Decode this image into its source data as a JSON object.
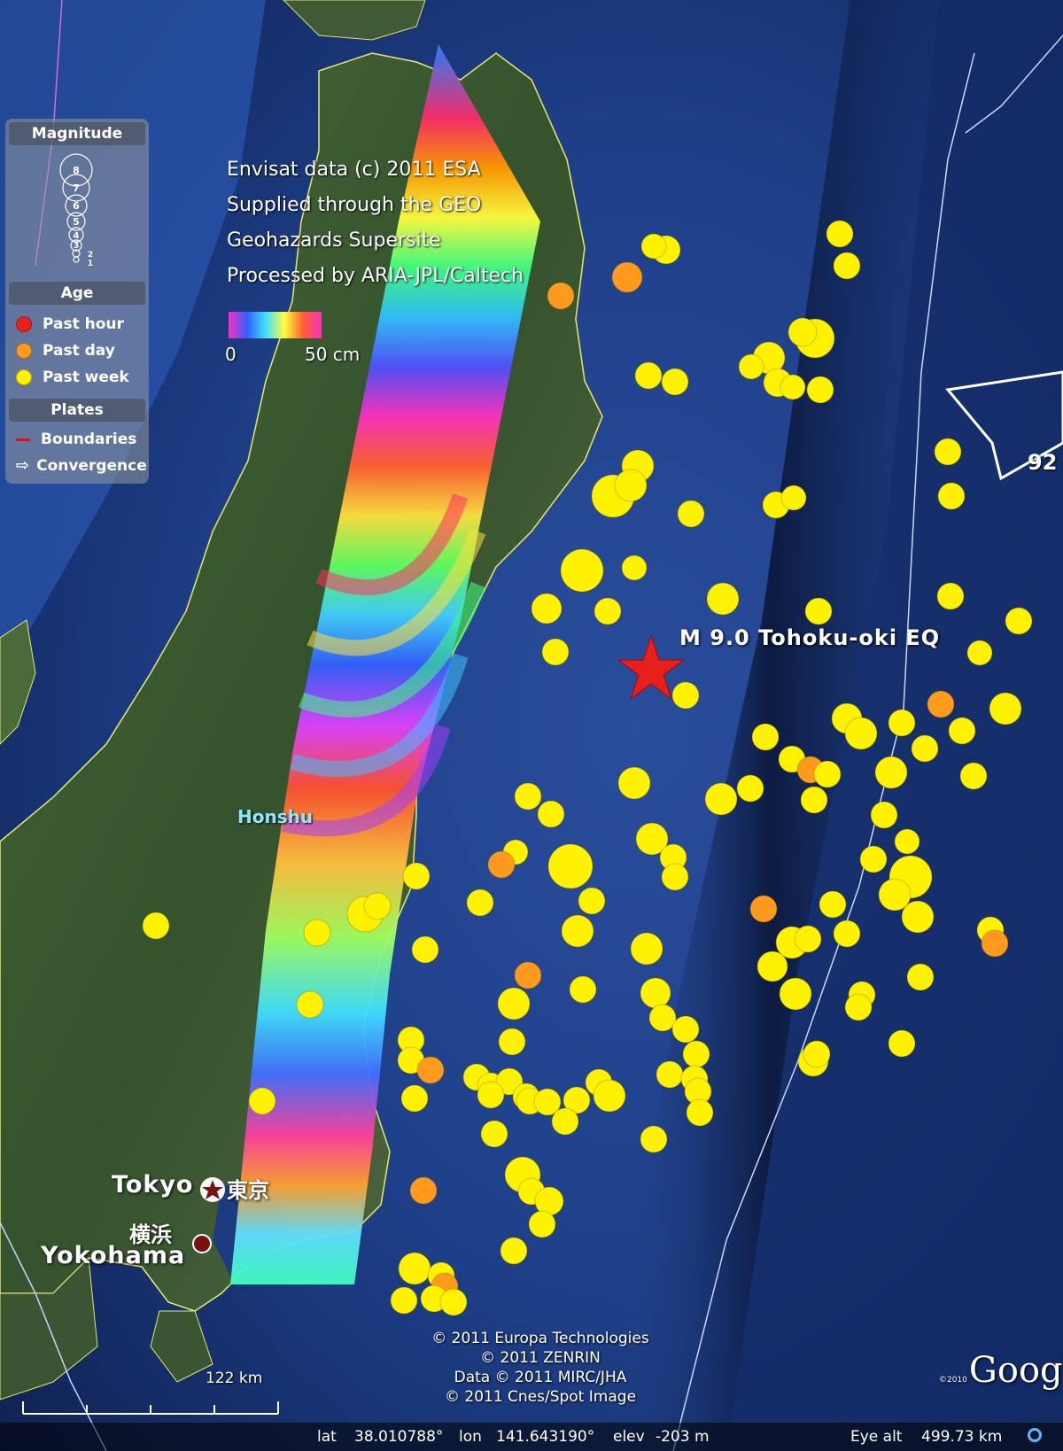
{
  "legend": {
    "magnitude_title": "Magnitude",
    "magnitude_scale": [
      "8",
      "7",
      "6",
      "5",
      "4",
      "3",
      "2",
      "1"
    ],
    "age_title": "Age",
    "age_items": [
      {
        "label": "Past hour",
        "color": "#e8201c"
      },
      {
        "label": "Past day",
        "color": "#ff9a1e"
      },
      {
        "label": "Past week",
        "color": "#fff200"
      }
    ],
    "plates_title": "Plates",
    "plates_items": [
      {
        "label": "Boundaries",
        "icon": "red-line-icon",
        "color": "#d11"
      },
      {
        "label": "Convergence",
        "icon": "arrow-right-icon"
      }
    ]
  },
  "credits": [
    "Envisat data (c) 2011 ESA",
    "Supplied through the GEO",
    "Geohazards Supersite",
    "Processed by ARIA-JPL/Caltech"
  ],
  "colorbar": {
    "min_label": "0",
    "max_label": "50 cm"
  },
  "epicenter": {
    "label": "M 9.0 Tohoku-oki EQ",
    "icon": "red-star-icon",
    "color": "#e8201c"
  },
  "places": {
    "honshu": "Honshu",
    "tokyo": "Tokyo",
    "tokyo_kanji": "東京",
    "yokohama": "Yokohama",
    "yokohama_kanji": "横浜"
  },
  "plate_rate": "92",
  "copyright": [
    "© 2011 Europa Technologies",
    "© 2011 ZENRIN",
    "Data © 2011 MIRC/JHA",
    "© 2011 Cnes/Spot Image"
  ],
  "google": {
    "brand": "Google",
    "year": "©2010"
  },
  "scale_bar": "122 km",
  "status": {
    "lat_label": "lat",
    "lat_value": "38.010788°",
    "lon_label": "lon",
    "lon_value": "141.643190°",
    "elev_label": "elev",
    "elev_value": "-203 m",
    "eye_label": "Eye alt",
    "eye_value": "499.73 km"
  },
  "colors": {
    "past_week": "#fff200",
    "past_day": "#ff9a1e",
    "ocean": "#1a3a8a",
    "land": "#3e5a32"
  }
}
